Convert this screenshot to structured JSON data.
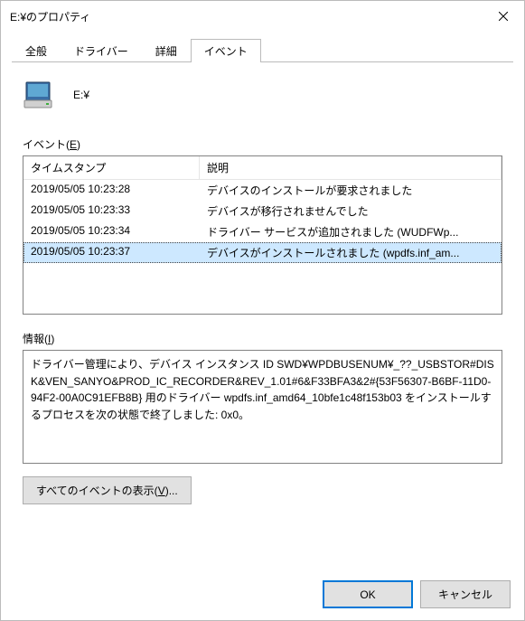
{
  "window": {
    "title": "E:¥のプロパティ"
  },
  "tabs": {
    "general": "全般",
    "driver": "ドライバー",
    "details": "詳細",
    "events": "イベント"
  },
  "device": {
    "name": "E:¥"
  },
  "sections": {
    "events_label_pre": "イベント(",
    "events_label_key": "E",
    "events_label_post": ")",
    "info_label_pre": "情報(",
    "info_label_key": "I",
    "info_label_post": ")"
  },
  "list": {
    "cols": {
      "timestamp": "タイムスタンプ",
      "desc": "説明"
    },
    "rows": [
      {
        "ts": "2019/05/05 10:23:28",
        "desc": "デバイスのインストールが要求されました"
      },
      {
        "ts": "2019/05/05 10:23:33",
        "desc": "デバイスが移行されませんでした"
      },
      {
        "ts": "2019/05/05 10:23:34",
        "desc": "ドライバー サービスが追加されました (WUDFWp..."
      },
      {
        "ts": "2019/05/05 10:23:37",
        "desc": "デバイスがインストールされました (wpdfs.inf_am..."
      }
    ],
    "selected_index": 3
  },
  "info": {
    "text": "ドライバー管理により、デバイス インスタンス ID SWD¥WPDBUSENUM¥_??_USBSTOR#DISK&VEN_SANYO&PROD_IC_RECORDER&REV_1.01#6&F33BFA3&2#{53F56307-B6BF-11D0-94F2-00A0C91EFB8B} 用のドライバー wpdfs.inf_amd64_10bfe1c48f153b03 をインストールするプロセスを次の状態で終了しました: 0x0。"
  },
  "buttons": {
    "show_all_pre": "すべてのイベントの表示(",
    "show_all_key": "V",
    "show_all_post": ")...",
    "ok": "OK",
    "cancel": "キャンセル"
  }
}
